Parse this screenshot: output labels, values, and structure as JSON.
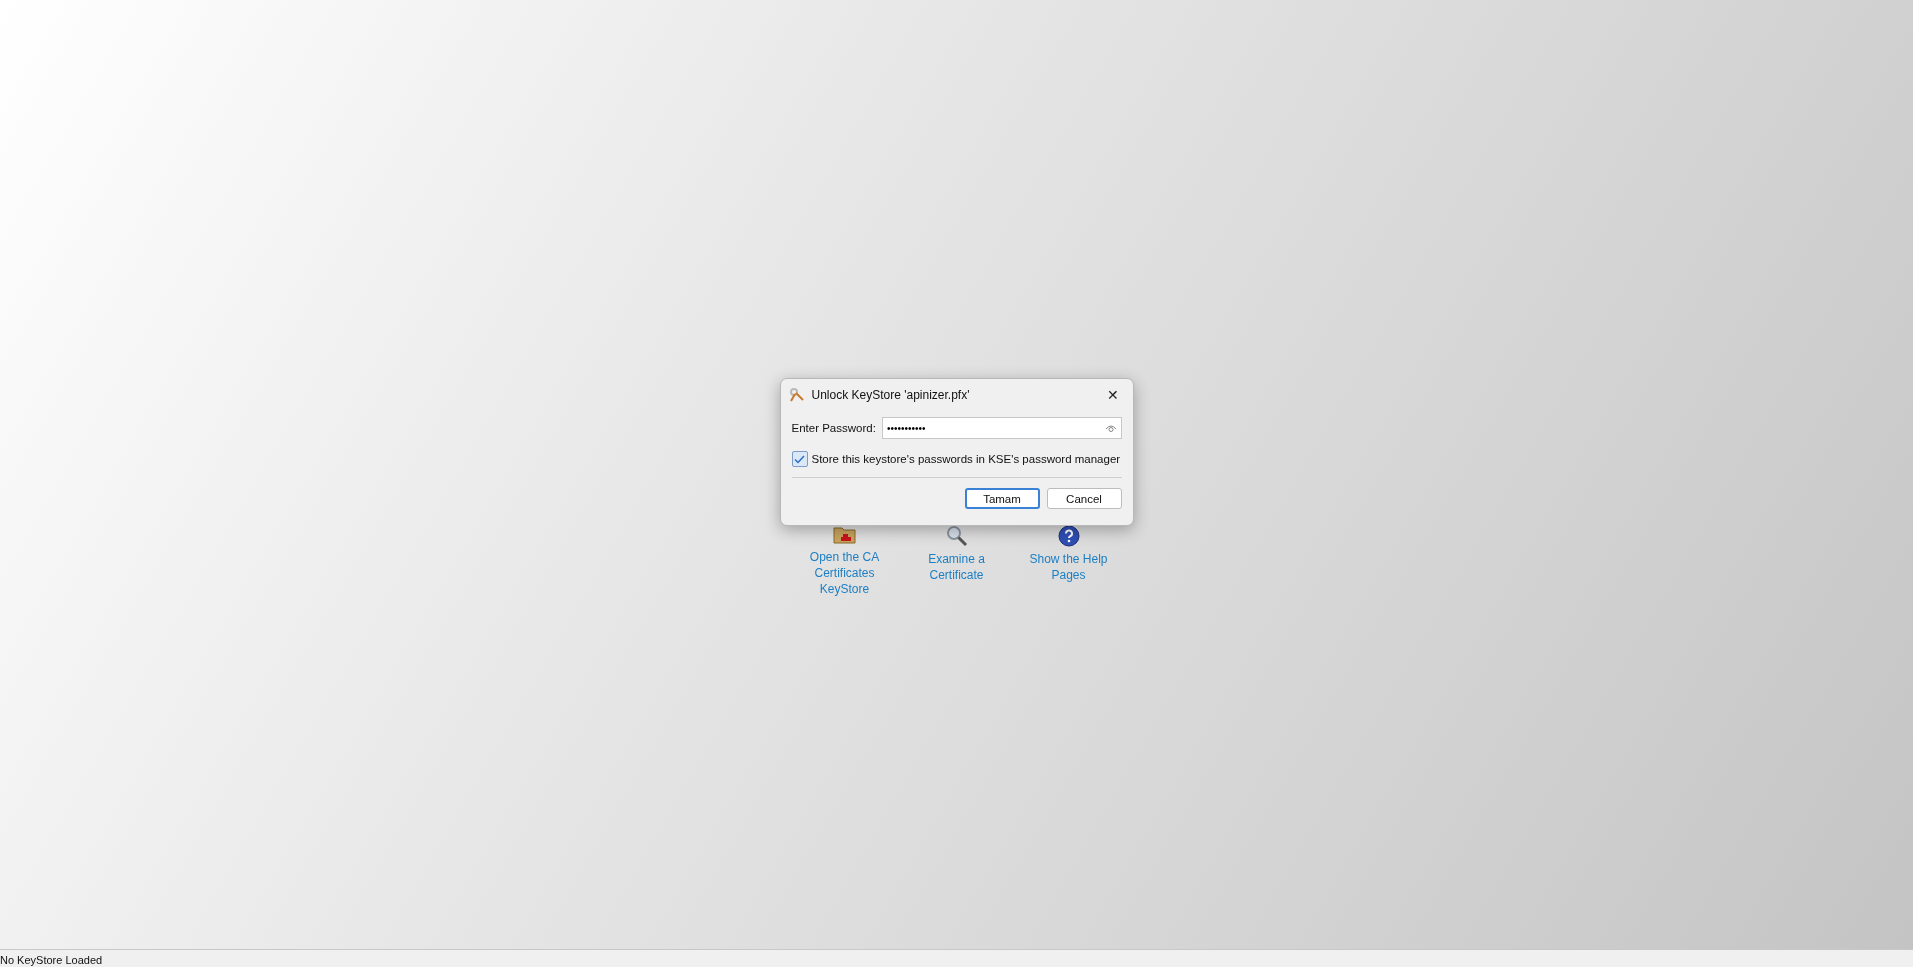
{
  "dialog": {
    "title": "Unlock KeyStore 'apinizer.pfx'",
    "close": "✕",
    "password_label": "Enter Password:",
    "password_value": "•••••••••••",
    "store_checkbox": {
      "label": "Store this keystore's passwords in KSE's password manager",
      "checked": true
    },
    "buttons": [
      {
        "label": "Tamam",
        "kind": "default"
      },
      {
        "label": "Cancel",
        "kind": "normal"
      }
    ]
  },
  "quick_links": [
    {
      "kind": "folder",
      "label": "Open the CA Certificates KeyStore"
    },
    {
      "kind": "magnifier",
      "label": "Examine a Certificate"
    },
    {
      "kind": "help",
      "label": "Show the Help Pages"
    }
  ],
  "status_bar": "No KeyStore Loaded"
}
